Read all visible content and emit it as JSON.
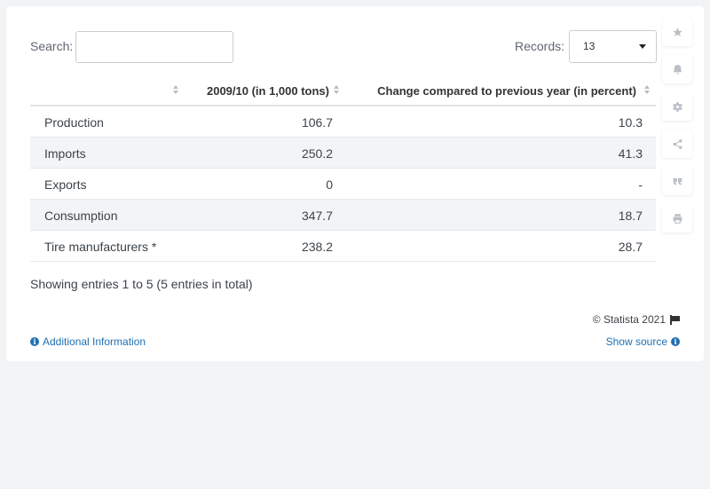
{
  "search": {
    "label": "Search:",
    "value": ""
  },
  "records": {
    "label": "Records:",
    "selected": "13"
  },
  "table": {
    "headers": [
      "",
      "2009/10 (in 1,000 tons)",
      "Change compared to previous year (in percent)"
    ],
    "rows": [
      [
        "Production",
        "106.7",
        "10.3"
      ],
      [
        "Imports",
        "250.2",
        "41.3"
      ],
      [
        "Exports",
        "0",
        "-"
      ],
      [
        "Consumption",
        "347.7",
        "18.7"
      ],
      [
        "Tire manufacturers *",
        "238.2",
        "28.7"
      ]
    ]
  },
  "summary": "Showing entries 1 to 5 (5 entries in total)",
  "footer": {
    "copyright": "© Statista 2021",
    "additional_info": "Additional Information",
    "show_source": "Show source"
  },
  "sidebar_icons": [
    "star-icon",
    "bell-icon",
    "gear-icon",
    "share-icon",
    "quote-icon",
    "print-icon"
  ],
  "colors": {
    "link": "#1f6fb2",
    "row_alt": "#f2f4f6",
    "icon": "#b9c0c7"
  }
}
